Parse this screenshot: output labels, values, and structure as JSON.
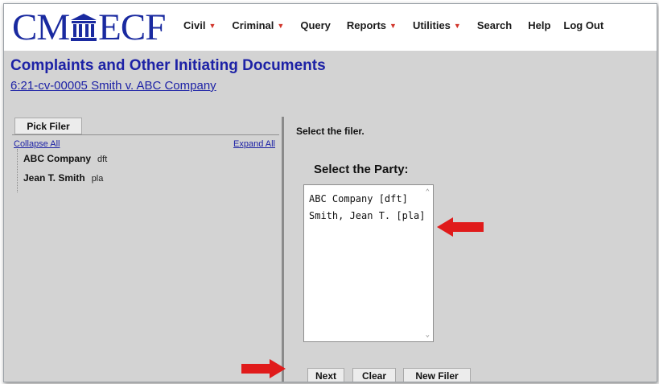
{
  "app": {
    "logo_left": "CM",
    "logo_right": "ECF"
  },
  "menu": [
    {
      "label": "Civil",
      "has_caret": true
    },
    {
      "label": "Criminal",
      "has_caret": true
    },
    {
      "label": "Query",
      "has_caret": false
    },
    {
      "label": "Reports",
      "has_caret": true
    },
    {
      "label": "Utilities",
      "has_caret": true
    },
    {
      "label": "Search",
      "has_caret": false
    },
    {
      "label": "Help",
      "has_caret": false
    },
    {
      "label": "Log Out",
      "has_caret": false
    }
  ],
  "header": {
    "title": "Complaints and Other Initiating Documents",
    "case_link": "6:21-cv-00005 Smith v. ABC Company"
  },
  "left_panel": {
    "pick_filer_label": "Pick Filer",
    "collapse_all": "Collapse All",
    "expand_all": "Expand All",
    "tree": [
      {
        "name": "ABC Company",
        "role": "dft"
      },
      {
        "name": "Jean T. Smith",
        "role": "pla"
      }
    ]
  },
  "right_panel": {
    "instruction": "Select the filer.",
    "party_heading": "Select the Party:",
    "options": [
      "ABC Company [dft]",
      "Smith, Jean T. [pla]"
    ],
    "buttons": {
      "next": "Next",
      "clear": "Clear",
      "new_filer": "New Filer"
    }
  },
  "icons": [
    "courthouse-pillar-icon",
    "red-arrow-icon"
  ],
  "colors": {
    "brand_blue": "#1a2aa0",
    "link_blue": "#1d22a6",
    "caret_red": "#d1352b",
    "arrow_red": "#e01b1b",
    "panel_gray": "#d3d3d3"
  }
}
